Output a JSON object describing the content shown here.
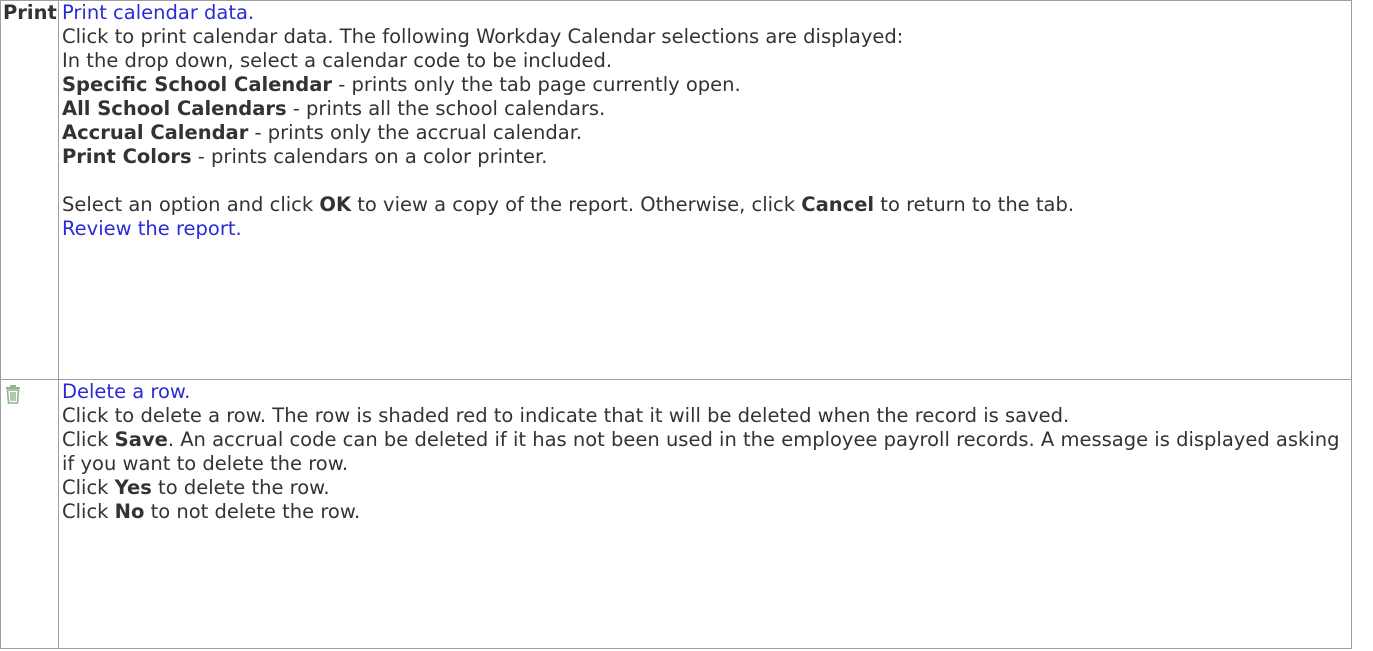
{
  "print_row": {
    "label": "Print",
    "link": "Print calendar data.",
    "intro": "Click to print calendar data. The following Workday Calendar selections are displayed:",
    "dropdown_note": "In the drop down, select a calendar code to be included.",
    "options": [
      {
        "name": "Specific School Calendar",
        "desc": " - prints only the tab page currently open."
      },
      {
        "name": "All School Calendars",
        "desc": " - prints all the school calendars."
      },
      {
        "name": "Accrual Calendar",
        "desc": " - prints only the accrual calendar."
      },
      {
        "name": "Print Colors",
        "desc": " - prints calendars on a color printer."
      }
    ],
    "select_pre": "Select an option and click ",
    "ok": "OK",
    "select_mid": " to view a copy of the report. Otherwise, click ",
    "cancel": "Cancel",
    "select_post": " to return to the tab.",
    "review_link": "Review the report."
  },
  "delete_row": {
    "icon": "trash-icon",
    "link": "Delete a row.",
    "intro": "Click to delete a row. The row is shaded red to indicate that it will be deleted when the record is saved.",
    "save_pre": "Click ",
    "save": "Save",
    "save_post": ". An accrual code can be deleted if it has not been used in the employee payroll records. A message is displayed asking if you want to delete the row.",
    "yes_pre": "Click ",
    "yes": "Yes",
    "yes_post": " to delete the row.",
    "no_pre": "Click ",
    "no": "No",
    "no_post": " to not delete the row."
  },
  "colors": {
    "link": "#2b2bd6",
    "text": "#333333",
    "border": "#9e9e9e",
    "icon": "#8fb38f"
  }
}
